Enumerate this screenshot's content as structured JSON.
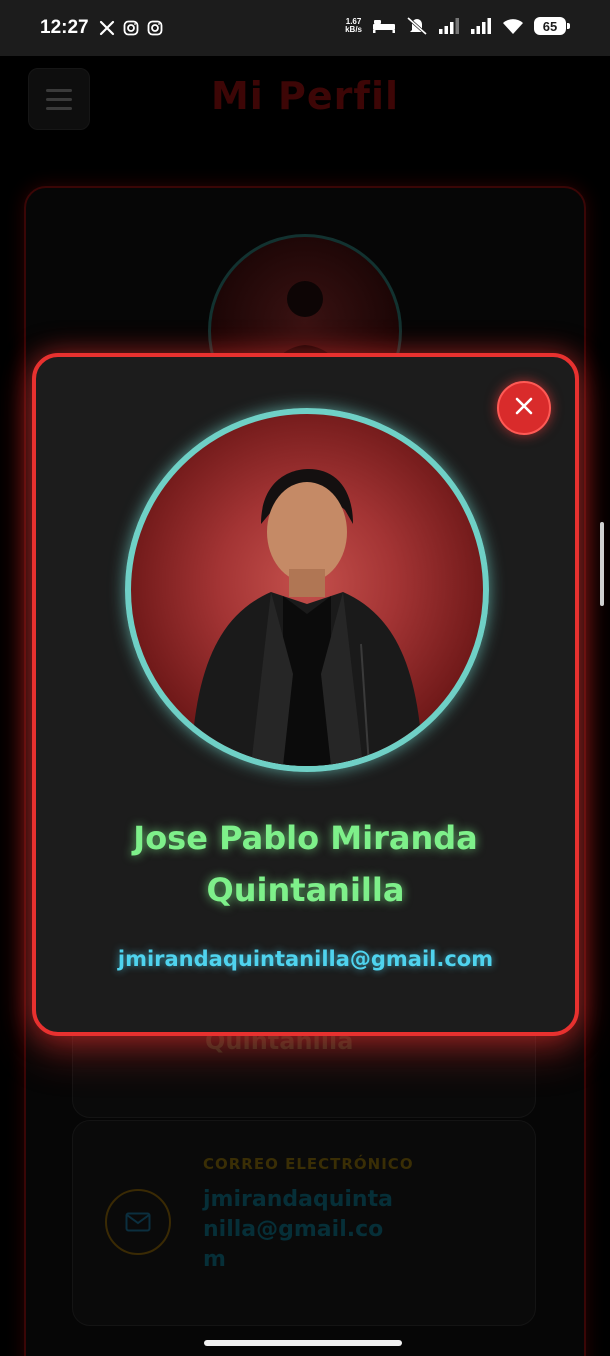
{
  "status_bar": {
    "time": "12:27",
    "left_icons": [
      "x-icon",
      "instagram-icon",
      "instagram-icon"
    ],
    "net_speed_value": "1.67",
    "net_speed_unit": "kB/s",
    "right_icons": [
      "bed-icon",
      "mute-icon",
      "signal-icon",
      "signal-icon",
      "wifi-icon"
    ],
    "battery": "65"
  },
  "page": {
    "title": "Mi Perfil",
    "name_fragment": "Quintanilla",
    "email_label": "CORREO ELECTRÓNICO",
    "email_value": "jmirandaquintanilla@gmail.com"
  },
  "modal": {
    "name": "Jose Pablo Miranda Quintanilla",
    "email": "jmirandaquintanilla@gmail.com",
    "close_icon": "close-icon"
  },
  "colors": {
    "accent_red": "#e8312f",
    "name_green": "#7ef08a",
    "email_cyan": "#4fd3ee",
    "avatar_ring": "#6fd0c6"
  }
}
